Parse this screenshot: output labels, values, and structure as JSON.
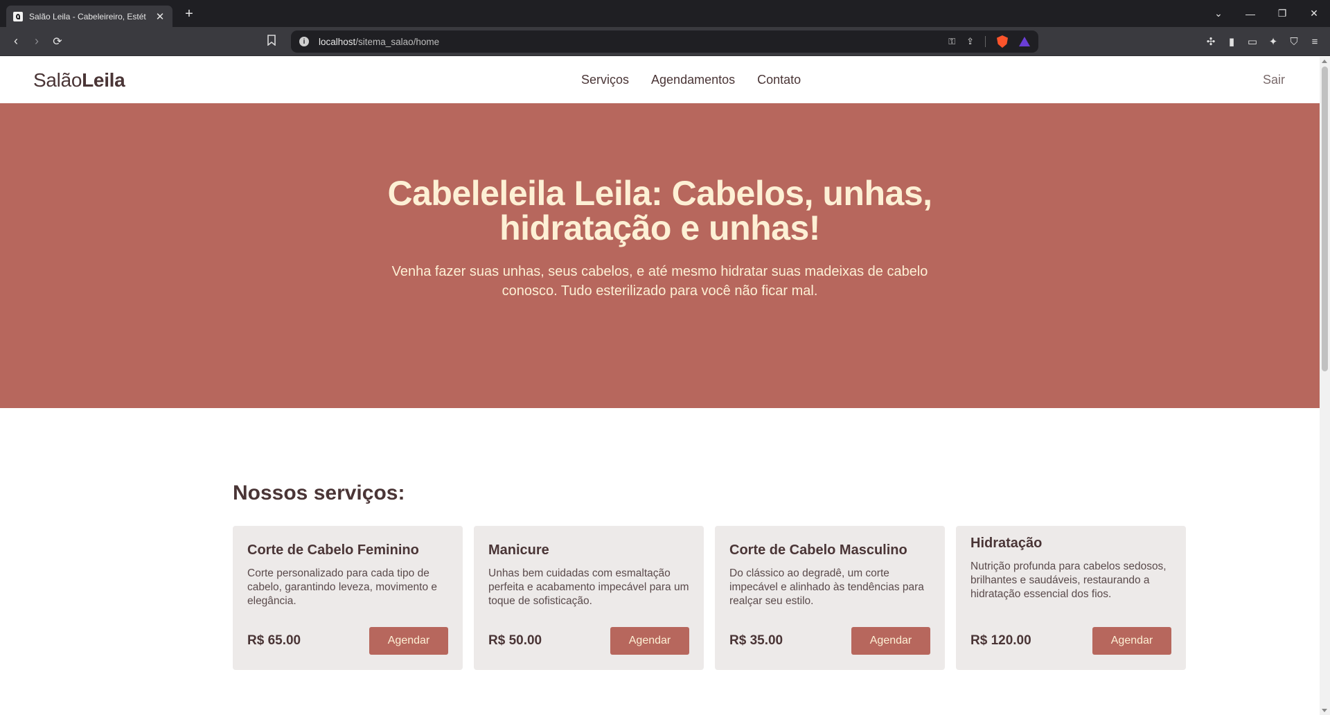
{
  "browser": {
    "tab_title": "Salão Leila - Cabeleireiro, Estét",
    "tab_close": "✕",
    "new_tab": "+",
    "url_host": "localhost",
    "url_path": "/sitema_salao/home",
    "window": {
      "dropdown": "⌄",
      "minimize": "—",
      "restore": "❐",
      "close": "✕"
    }
  },
  "header": {
    "brand_light": "Salão",
    "brand_bold": "Leila",
    "nav": [
      "Serviços",
      "Agendamentos",
      "Contato"
    ],
    "logout": "Sair"
  },
  "hero": {
    "title": "Cabeleleila Leila: Cabelos, unhas, hidratação e unhas!",
    "subtitle": "Venha fazer suas unhas, seus cabelos, e até mesmo hidratar suas madeixas de cabelo conosco. Tudo esterilizado para você não ficar mal."
  },
  "services": {
    "heading": "Nossos serviços:",
    "button_label": "Agendar",
    "items": [
      {
        "title": "Corte de Cabelo Feminino",
        "description": "Corte personalizado para cada tipo de cabelo, garantindo leveza, movimento e elegância.",
        "price": "R$ 65.00"
      },
      {
        "title": "Manicure",
        "description": "Unhas bem cuidadas com esmaltação perfeita e acabamento impecável para um toque de sofisticação.",
        "price": "R$ 50.00"
      },
      {
        "title": "Corte de Cabelo Masculino",
        "description": "Do clássico ao degradê, um corte impecável e alinhado às tendências para realçar seu estilo.",
        "price": "R$ 35.00"
      },
      {
        "title": "Hidratação",
        "description": "Nutrição profunda para cabelos sedosos, brilhantes e saudáveis, restaurando a hidratação essencial dos fios.",
        "price": "R$ 120.00"
      }
    ]
  },
  "colors": {
    "accent": "#b7675d",
    "cream": "#fdf0d5",
    "text": "#4a3536",
    "card": "#edeae9"
  }
}
